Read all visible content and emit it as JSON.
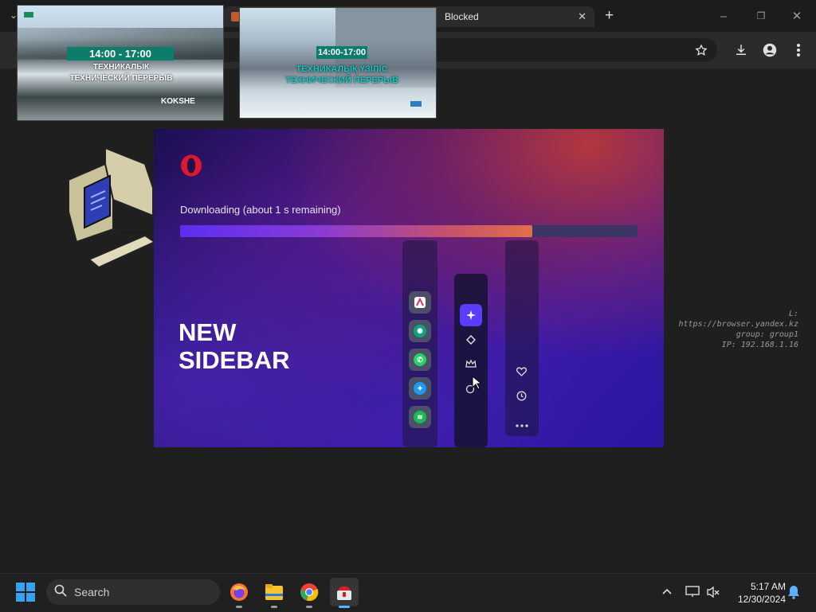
{
  "browser": {
    "active_tab_title": "Blocked",
    "new_tab_symbol": "+",
    "close_tab_symbol": "✕",
    "window_controls": {
      "minimize": "–",
      "maximize": "❐",
      "close": "✕"
    },
    "toolbar_icons": [
      "star-icon",
      "download-icon",
      "profile-icon",
      "menu-dots-icon"
    ]
  },
  "thumbnails": [
    {
      "time": "14:00 - 17:00",
      "caption_line1": "ТЕХНИКАЛЫК",
      "caption_line2": "ТЕХНИЧЕСКИЙ ПЕРЕРЫВ",
      "watermark": "KOKSHE"
    },
    {
      "time": "14:00-17:00",
      "caption_line1": "ТЕХНИКАЛЫҚ ҮЗІЛІС",
      "caption_line2": "ТЕХНИЧЕСКИЙ ПЕРЕРЫВ"
    }
  ],
  "installer": {
    "status_text": "Downloading (about 1 s remaining)",
    "progress_fraction": 0.77,
    "headline_line1": "NEW",
    "headline_line2": "SIDEBAR",
    "logo": "opera-logo",
    "colors": {
      "accent": "#5a3cff",
      "progress_end": "#e0704a"
    }
  },
  "background_info": {
    "url_line": "L: https://browser.yandex.kz",
    "group_line": "group: group1",
    "ip_line": "IP: 192.168.1.16"
  },
  "taskbar": {
    "search_placeholder": "Search",
    "time": "5:17 AM",
    "date": "12/30/2024",
    "apps": [
      "firefox-icon",
      "file-explorer-icon",
      "chrome-icon",
      "installer-icon"
    ]
  }
}
